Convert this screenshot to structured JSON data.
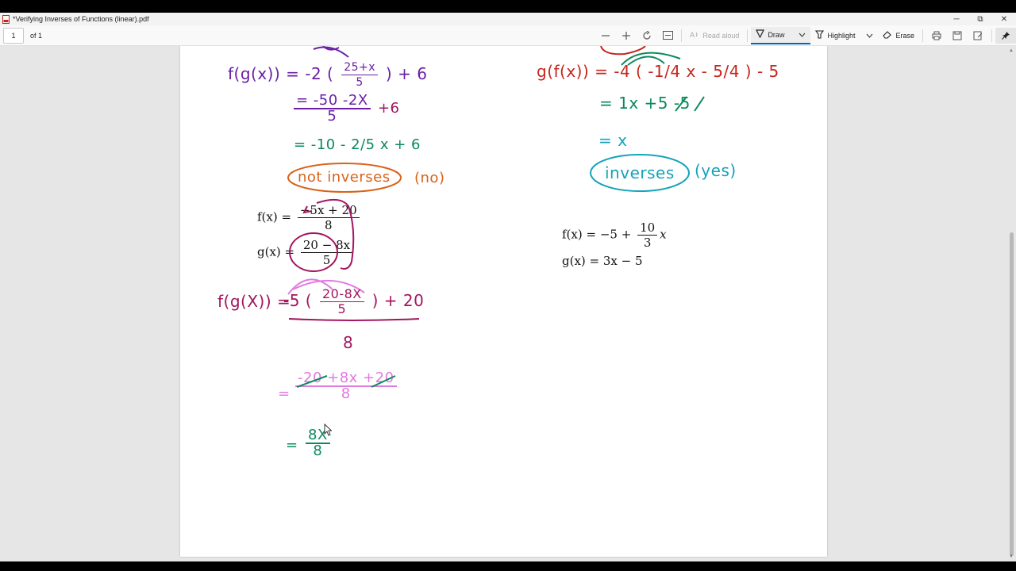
{
  "window": {
    "title": "*Verifying Inverses of Functions (linear).pdf",
    "minimize": "─",
    "maximize": "⧉",
    "close": "✕"
  },
  "toolbar": {
    "page_number": "1",
    "page_of": "of 1",
    "read_aloud": "Read aloud",
    "draw": "Draw",
    "highlight": "Highlight",
    "erase": "Erase"
  },
  "left": {
    "fg1_line1": "f(g(x)) = -2 (",
    "fg1_frac_num": "25+x",
    "fg1_frac_den": "5",
    "fg1_tail": ") + 6",
    "fg1_line2_num": "= -50 -2X",
    "fg1_line2_tail": "+6",
    "fg1_line2_den": "5",
    "fg1_line3": "= -10 - 2/5 x + 6",
    "not_inverses": "not inverses",
    "no": "(no)",
    "f_def_left": "f(x) =",
    "f_def_num": "−5x + 20",
    "f_def_den": "8",
    "g_def_left": "g(x) =",
    "g_def_num": "20 − 8x",
    "g_def_den": "5",
    "fg2_left": "f(g(X)) =",
    "fg2_mid": "-5 (",
    "fg2_inner_num": "20-8X",
    "fg2_inner_den": "5",
    "fg2_tail": ") + 20",
    "fg2_den": "8",
    "fg2_step_eq": "=",
    "fg2_step_num": "-20 +8x +20",
    "fg2_step_den": "8",
    "fg2_final_eq": "=",
    "fg2_final_num": "8X",
    "fg2_final_den": "8"
  },
  "right": {
    "gf1_line1": "g(f(x)) = -4 ( -1/4 x - 5/4 ) - 5",
    "gf1_line2": "= 1x +5 -5",
    "gf1_line3": "= x",
    "inverses": "inverses",
    "yes": "(yes)",
    "f_def_left": "f(x) = −5 +",
    "f_def_num": "10",
    "f_def_den": "3",
    "f_def_var": "x",
    "g_def": "g(x) = 3x − 5"
  },
  "colors": {
    "purple": "#6a1fa6",
    "magenta": "#a3155f",
    "green": "#0b8a5c",
    "orange": "#d9621a",
    "red": "#c4261d",
    "teal": "#14a3b8",
    "pink": "#e07be0",
    "accent": "#0067c0"
  }
}
